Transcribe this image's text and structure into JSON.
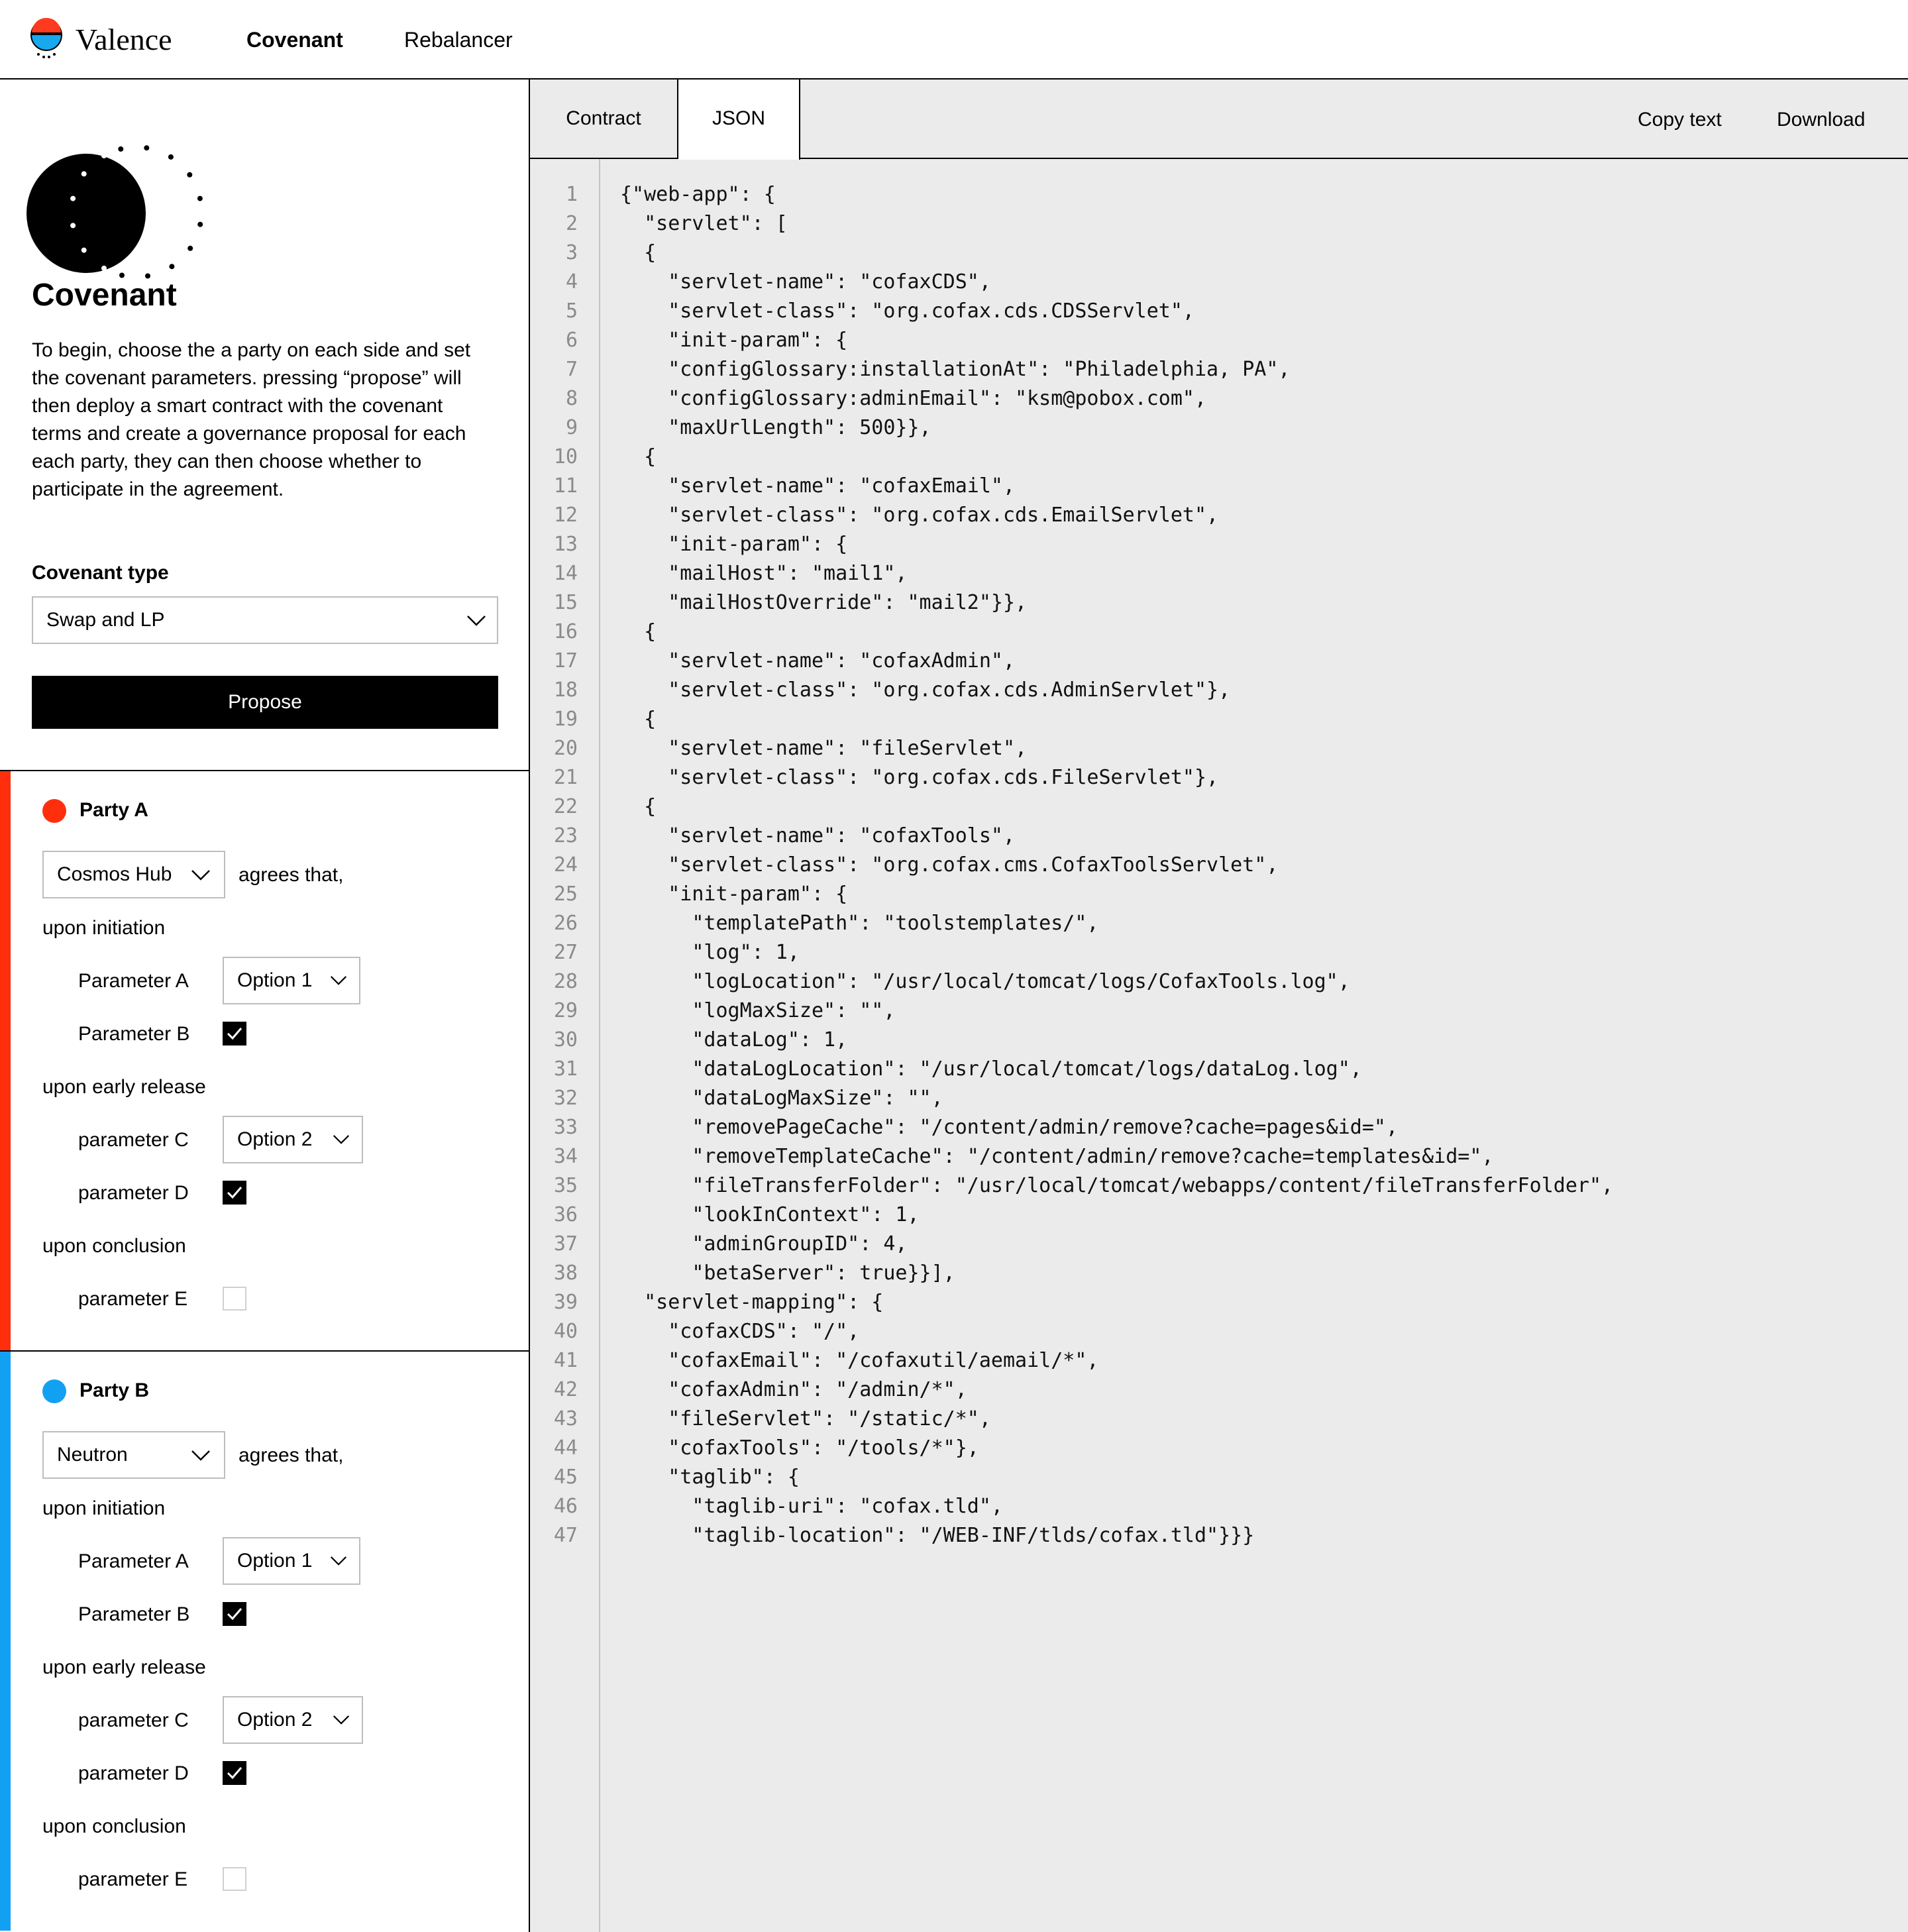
{
  "header": {
    "brand": "Valence",
    "nav": [
      {
        "label": "Covenant",
        "active": true
      },
      {
        "label": "Rebalancer",
        "active": false
      }
    ]
  },
  "sidebar": {
    "title": "Covenant",
    "intro": "To begin, choose the a party on each side and set the covenant parameters. pressing “propose” will then deploy a smart contract with the covenant terms and create a governance proposal for each each party, they can then choose whether to participate in the agreement.",
    "covenant_type_label": "Covenant type",
    "covenant_type_value": "Swap and LP",
    "propose_label": "Propose"
  },
  "parties": [
    {
      "name": "Party A",
      "color": "#ff2f0e",
      "chain": "Cosmos Hub",
      "agrees": "agrees that,",
      "initiation_label": "upon initiation",
      "param_a_label": "Parameter A",
      "param_a_value": "Option 1",
      "param_b_label": "Parameter B",
      "param_b_checked": true,
      "early_label": "upon early release",
      "param_c_label": "parameter C",
      "param_c_value": "Option 2",
      "param_d_label": "parameter D",
      "param_d_checked": true,
      "conclusion_label": "upon conclusion",
      "param_e_label": "parameter E",
      "param_e_checked": false
    },
    {
      "name": "Party B",
      "color": "#12a1f2",
      "chain": "Neutron",
      "agrees": "agrees that,",
      "initiation_label": "upon initiation",
      "param_a_label": "Parameter A",
      "param_a_value": "Option 1",
      "param_b_label": "Parameter B",
      "param_b_checked": true,
      "early_label": "upon early release",
      "param_c_label": "parameter C",
      "param_c_value": "Option 2",
      "param_d_label": "parameter D",
      "param_d_checked": true,
      "conclusion_label": "upon conclusion",
      "param_e_label": "parameter E",
      "param_e_checked": false
    }
  ],
  "editor": {
    "tabs": [
      {
        "label": "Contract",
        "active": false
      },
      {
        "label": "JSON",
        "active": true
      }
    ],
    "copy_label": "Copy text",
    "download_label": "Download",
    "lines": [
      "{\"web-app\": {",
      "  \"servlet\": [",
      "  {",
      "    \"servlet-name\": \"cofaxCDS\",",
      "    \"servlet-class\": \"org.cofax.cds.CDSServlet\",",
      "    \"init-param\": {",
      "    \"configGlossary:installationAt\": \"Philadelphia, PA\",",
      "    \"configGlossary:adminEmail\": \"ksm@pobox.com\",",
      "    \"maxUrlLength\": 500}},",
      "  {",
      "    \"servlet-name\": \"cofaxEmail\",",
      "    \"servlet-class\": \"org.cofax.cds.EmailServlet\",",
      "    \"init-param\": {",
      "    \"mailHost\": \"mail1\",",
      "    \"mailHostOverride\": \"mail2\"}},",
      "  {",
      "    \"servlet-name\": \"cofaxAdmin\",",
      "    \"servlet-class\": \"org.cofax.cds.AdminServlet\"},",
      "  {",
      "    \"servlet-name\": \"fileServlet\",",
      "    \"servlet-class\": \"org.cofax.cds.FileServlet\"},",
      "  {",
      "    \"servlet-name\": \"cofaxTools\",",
      "    \"servlet-class\": \"org.cofax.cms.CofaxToolsServlet\",",
      "    \"init-param\": {",
      "      \"templatePath\": \"toolstemplates/\",",
      "      \"log\": 1,",
      "      \"logLocation\": \"/usr/local/tomcat/logs/CofaxTools.log\",",
      "      \"logMaxSize\": \"\",",
      "      \"dataLog\": 1,",
      "      \"dataLogLocation\": \"/usr/local/tomcat/logs/dataLog.log\",",
      "      \"dataLogMaxSize\": \"\",",
      "      \"removePageCache\": \"/content/admin/remove?cache=pages&id=\",",
      "      \"removeTemplateCache\": \"/content/admin/remove?cache=templates&id=\",",
      "      \"fileTransferFolder\": \"/usr/local/tomcat/webapps/content/fileTransferFolder\",",
      "      \"lookInContext\": 1,",
      "      \"adminGroupID\": 4,",
      "      \"betaServer\": true}}],",
      "  \"servlet-mapping\": {",
      "    \"cofaxCDS\": \"/\",",
      "    \"cofaxEmail\": \"/cofaxutil/aemail/*\",",
      "    \"cofaxAdmin\": \"/admin/*\",",
      "    \"fileServlet\": \"/static/*\",",
      "    \"cofaxTools\": \"/tools/*\"},",
      "    \"taglib\": {",
      "      \"taglib-uri\": \"cofax.tld\",",
      "      \"taglib-location\": \"/WEB-INF/tlds/cofax.tld\"}}}"
    ]
  }
}
